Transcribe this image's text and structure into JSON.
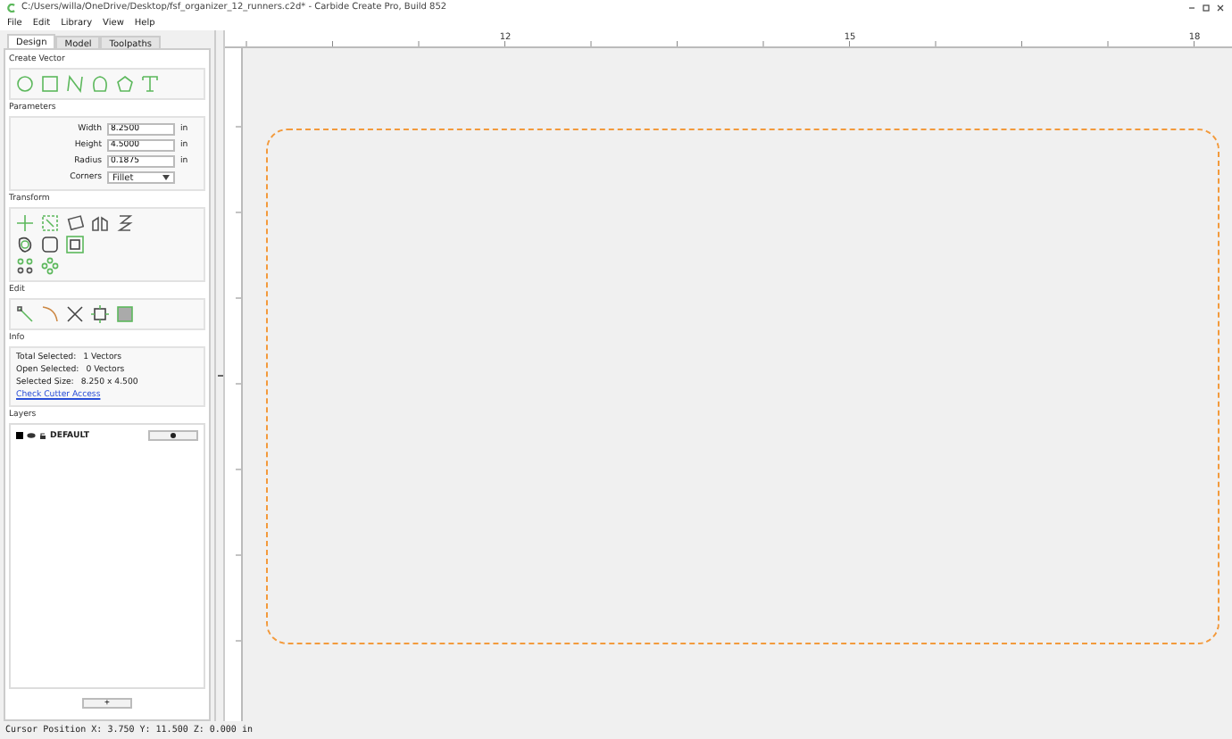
{
  "window": {
    "title": "C:/Users/willa/OneDrive/Desktop/fsf_organizer_12_runners.c2d* - Carbide Create Pro, Build 852"
  },
  "menu": [
    "File",
    "Edit",
    "Library",
    "View",
    "Help"
  ],
  "tabs": [
    {
      "label": "Design",
      "selected": true
    },
    {
      "label": "Model",
      "selected": false
    },
    {
      "label": "Toolpaths",
      "selected": false
    }
  ],
  "create_vector": {
    "title": "Create Vector"
  },
  "parameters": {
    "title": "Parameters",
    "fields": [
      {
        "label": "Width",
        "value": "8.2500",
        "unit": "in"
      },
      {
        "label": "Height",
        "value": "4.5000",
        "unit": "in"
      },
      {
        "label": "Radius",
        "value": "0.1875",
        "unit": "in"
      }
    ],
    "corners": {
      "label": "Corners",
      "value": "Fillet"
    }
  },
  "transform": {
    "title": "Transform"
  },
  "edit": {
    "title": "Edit"
  },
  "info": {
    "title": "Info",
    "rows": [
      {
        "label": "Total Selected:",
        "value": "1 Vectors"
      },
      {
        "label": "Open Selected:",
        "value": "0 Vectors"
      },
      {
        "label": "Selected Size:",
        "value": "8.250 x 4.500"
      }
    ],
    "link": "Check Cutter Access"
  },
  "layers": {
    "title": "Layers",
    "items": [
      {
        "name": "DEFAULT",
        "color": "#000000"
      }
    ],
    "add_button": "+"
  },
  "ruler": {
    "labels": [
      "12",
      "15",
      "18"
    ]
  },
  "status_bar": "Cursor Position X: 3.750 Y: 11.500 Z: 0.000 in"
}
